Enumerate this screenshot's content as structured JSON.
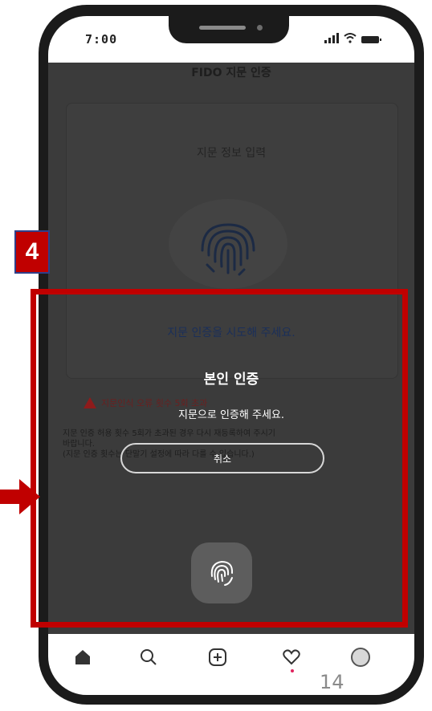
{
  "status_bar": {
    "time": "7:00"
  },
  "background_screen": {
    "header_title": "FIDO 지문 인증",
    "card_title": "지문 정보 입력",
    "prompt": "지문 인증을 시도해 주세요.",
    "warning": "지문인식 오류 횟수 5회 초과",
    "notice_lines": [
      "지문 인증 허용 횟수 5회가 초과된 경우 다시 재등록하여 주시기",
      "바랍니다.",
      "(지문 인증 횟수는 단말기 설정에 따라 다를 수 있습니다.)"
    ]
  },
  "dialog": {
    "title": "본인 인증",
    "message": "지문으로 인증해 주세요.",
    "cancel_label": "취소"
  },
  "bottom_nav": {
    "items": [
      "home-icon",
      "search-icon",
      "add-icon",
      "heart-icon",
      "profile-icon"
    ]
  },
  "annotation": {
    "step_number": "4",
    "page_number": "14",
    "highlight_color": "#c00000"
  }
}
